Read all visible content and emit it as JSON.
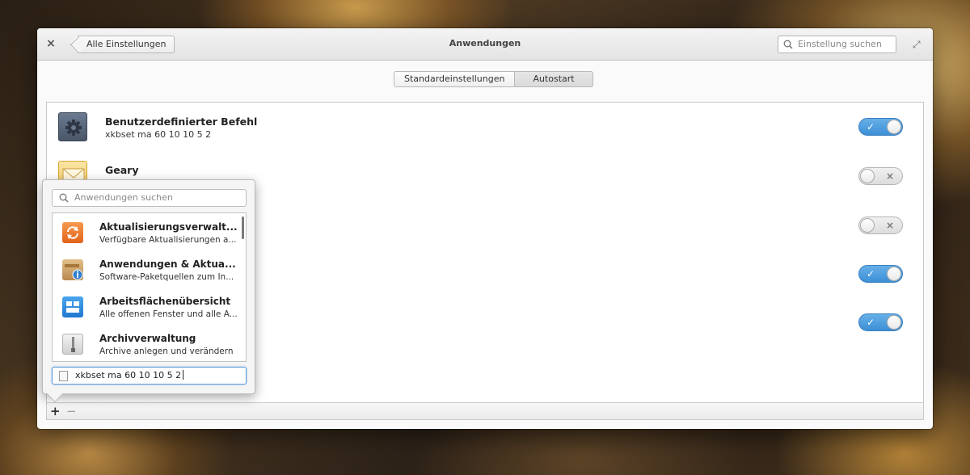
{
  "window": {
    "title": "Anwendungen",
    "back_label": "Alle Einstellungen",
    "search_placeholder": "Einstellung suchen",
    "close_glyph": "×",
    "maximize_glyph": "⤢"
  },
  "mode_switch": {
    "tabs": [
      {
        "label": "Standardeinstellungen",
        "active": false
      },
      {
        "label": "Autostart",
        "active": true
      }
    ]
  },
  "autostart_list": [
    {
      "title": "Benutzerdefinierter Befehl",
      "subtitle": "xkbset ma 60 10 10 5 2",
      "icon": "gear-icon",
      "enabled": true
    },
    {
      "title": "Geary",
      "subtitle": "",
      "icon": "mail-icon",
      "enabled": false
    },
    {
      "title": "",
      "subtitle": "",
      "icon": "",
      "enabled": false
    },
    {
      "title": "",
      "subtitle": "",
      "icon": "",
      "enabled": true
    },
    {
      "title": "",
      "subtitle": "",
      "icon": "",
      "enabled": true
    }
  ],
  "toggle_glyphs": {
    "on": "✓",
    "off": "×"
  },
  "actionbar": {
    "add_glyph": "+",
    "remove_glyph": "−"
  },
  "popover": {
    "search_placeholder": "Anwendungen suchen",
    "apps": [
      {
        "title": "Aktualisierungsverwalt...",
        "subtitle": "Verfügbare Aktualisierungen a...",
        "icon": "update-manager-icon",
        "color": "#f07a2d"
      },
      {
        "title": "Anwendungen & Aktua...",
        "subtitle": "Software-Paketquellen zum In...",
        "icon": "software-sources-icon",
        "color": "#c89a5b"
      },
      {
        "title": "Arbeitsflächenübersicht",
        "subtitle": "Alle offenen Fenster und alle A...",
        "icon": "workspace-overview-icon",
        "color": "#2f8ee0"
      },
      {
        "title": "Archivverwaltung",
        "subtitle": "Archive anlegen und verändern",
        "icon": "archive-manager-icon",
        "color": "#d8d8d8"
      }
    ],
    "command_value": "xkbset ma 60 10 10 5 2"
  }
}
